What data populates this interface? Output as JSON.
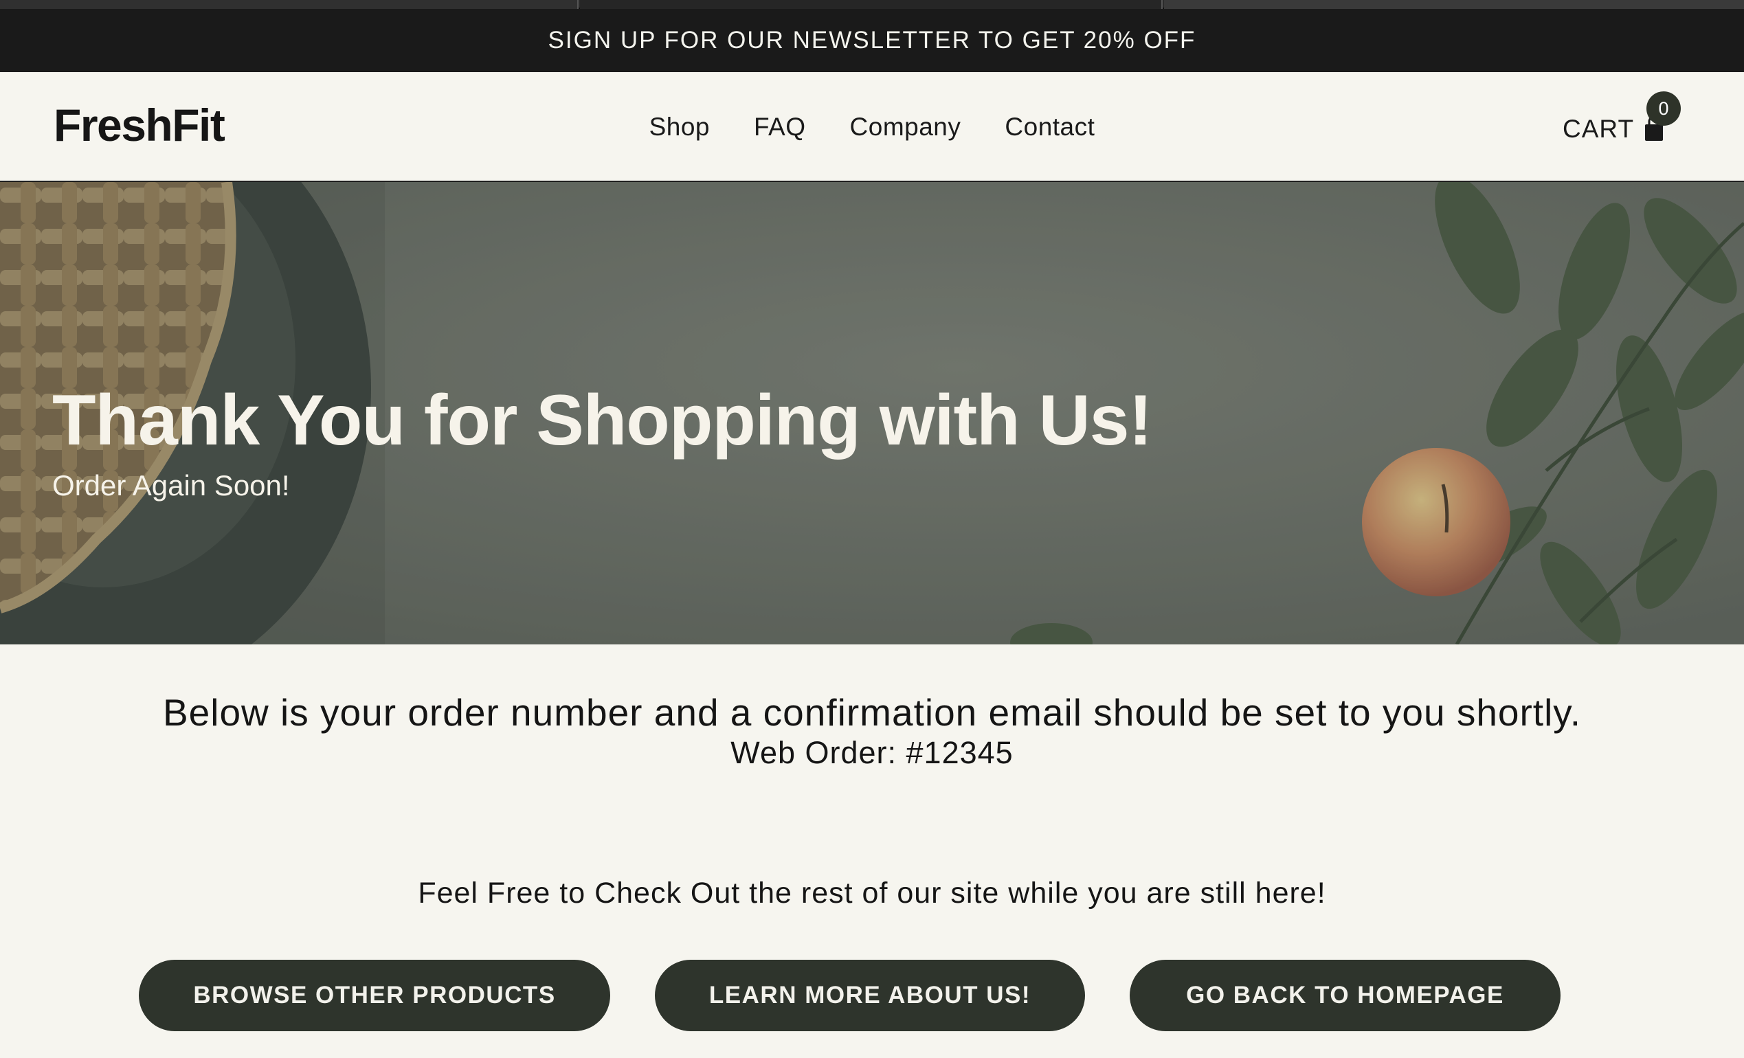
{
  "announcement": "SIGN UP FOR OUR NEWSLETTER TO GET 20% OFF",
  "header": {
    "logo": "FreshFit",
    "nav": [
      "Shop",
      "FAQ",
      "Company",
      "Contact"
    ],
    "cart_label": "CART",
    "cart_count": "0"
  },
  "hero": {
    "title": "Thank You for Shopping with Us!",
    "subtitle": "Order Again Soon!"
  },
  "confirmation": {
    "message": "Below is your order number and a confirmation email should be set to you shortly.",
    "order_number": "Web Order: #12345"
  },
  "explore": {
    "message": "Feel Free to Check Out the rest of our site while you are still here!",
    "buttons": [
      "BROWSE OTHER PRODUCTS",
      "LEARN MORE ABOUT US!",
      "GO BACK TO HOMEPAGE"
    ]
  },
  "colors": {
    "announcement_bg": "#1a1a1a",
    "page_bg": "#f6f5ef",
    "button_bg": "#2e342c",
    "hero_overlay": "#6c7168"
  },
  "icons": [
    "shopping-bag-icon"
  ]
}
